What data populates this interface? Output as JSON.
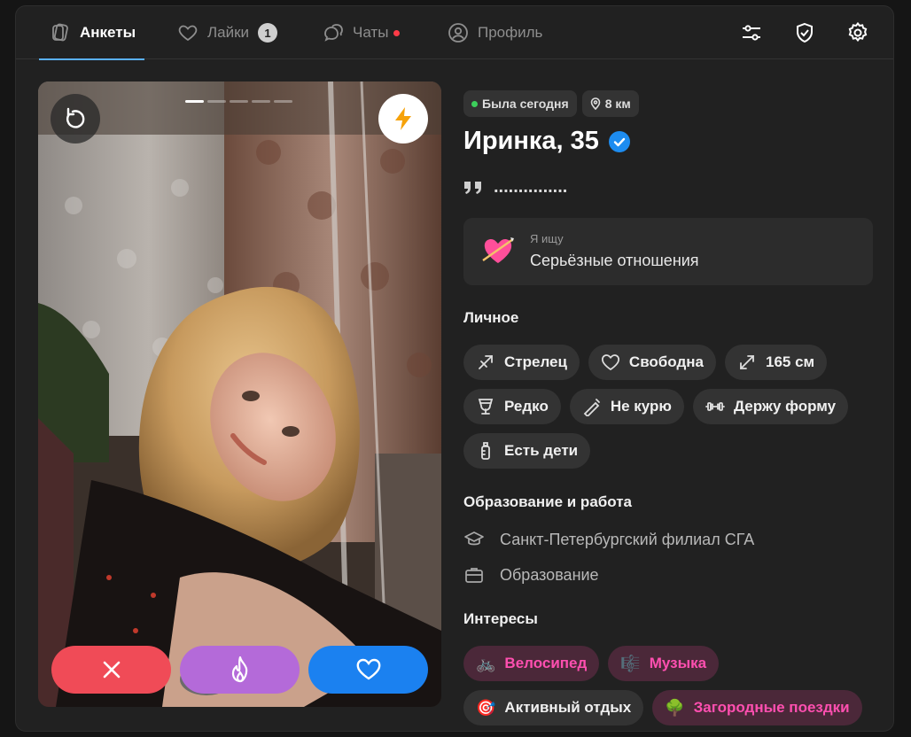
{
  "nav": {
    "tabs": [
      {
        "label": "Анкеты",
        "icon": "cards-icon",
        "active": true
      },
      {
        "label": "Лайки",
        "icon": "heart-icon",
        "badge": "1"
      },
      {
        "label": "Чаты",
        "icon": "chat-icon",
        "dot": true
      },
      {
        "label": "Профиль",
        "icon": "profile-icon"
      }
    ],
    "right_icons": [
      "filters-icon",
      "shield-check-icon",
      "settings-icon"
    ]
  },
  "photo": {
    "slides_total": 5,
    "slide_active": 1,
    "buttons": [
      "undo-icon",
      "boost-lightning-icon"
    ],
    "actions": [
      "dislike-x-icon",
      "superlike-fire-icon",
      "like-heart-icon"
    ]
  },
  "profile": {
    "status": "Была сегодня",
    "distance": "8 км",
    "name_age": "Иринка, 35",
    "verified": true,
    "bio": "...............",
    "looking_for": {
      "label": "Я ищу",
      "value": "Серьёзные отношения"
    },
    "personal_title": "Личное",
    "personal": [
      [
        "Стрелец",
        "Свободна",
        "165 см"
      ],
      [
        "Редко",
        "Не курю",
        "Держу форму"
      ],
      [
        "Есть дети"
      ]
    ],
    "education_title": "Образование и работа",
    "university": "Санкт-Петербургский филиал СГА",
    "education": "Образование",
    "interests_title": "Интересы",
    "interests": [
      {
        "label": "Велосипед",
        "emoji": "🚲"
      },
      {
        "label": "Музыка",
        "emoji": "🎼"
      },
      {
        "label": "Активный отдых",
        "emoji": "🎯"
      },
      {
        "label": "Загородные поездки",
        "emoji": "🌳"
      }
    ]
  },
  "colors": {
    "accent": "#5ab0ff",
    "dislike": "#f04b57",
    "superlike": "#b46ad9",
    "like": "#1b81f0",
    "interest_text": "#ff4fb0"
  }
}
